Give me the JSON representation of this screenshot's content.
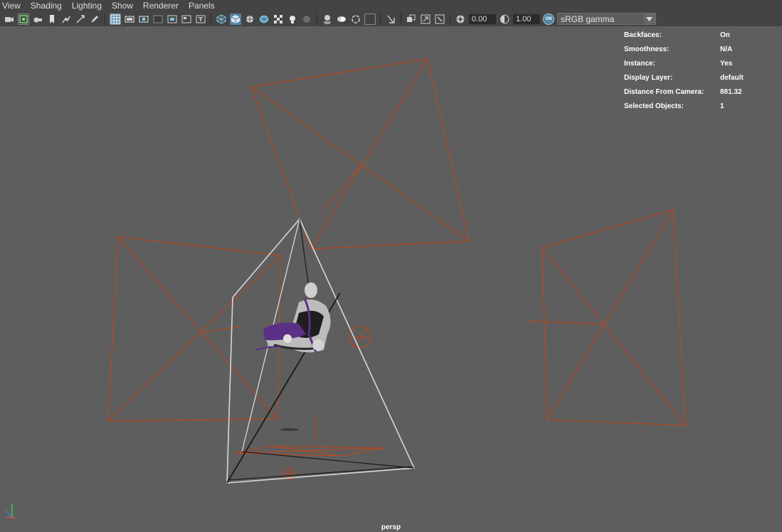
{
  "menu": [
    "View",
    "Shading",
    "Lighting",
    "Show",
    "Renderer",
    "Panels"
  ],
  "toolbar": {
    "exposure": "0.00",
    "gamma": "1.00",
    "cm_badge": "ON",
    "color_space": "sRGB gamma"
  },
  "hud": [
    {
      "label": "Backfaces:",
      "value": "On"
    },
    {
      "label": "Smoothness:",
      "value": "N/A"
    },
    {
      "label": "Instance:",
      "value": "Yes"
    },
    {
      "label": "Display Layer:",
      "value": "default"
    },
    {
      "label": "Distance From Camera:",
      "value": "881.32"
    },
    {
      "label": "Selected Objects:",
      "value": "1"
    }
  ],
  "camera_label": "persp",
  "colors": {
    "viewport_bg": "#5e5e5e",
    "light_wire": "#c0461a",
    "selected_wire": "#d8d8d8",
    "active_button": "#5285a6",
    "axis_x": "#e04040",
    "axis_y": "#40d040",
    "axis_z": "#4a7ad8"
  }
}
